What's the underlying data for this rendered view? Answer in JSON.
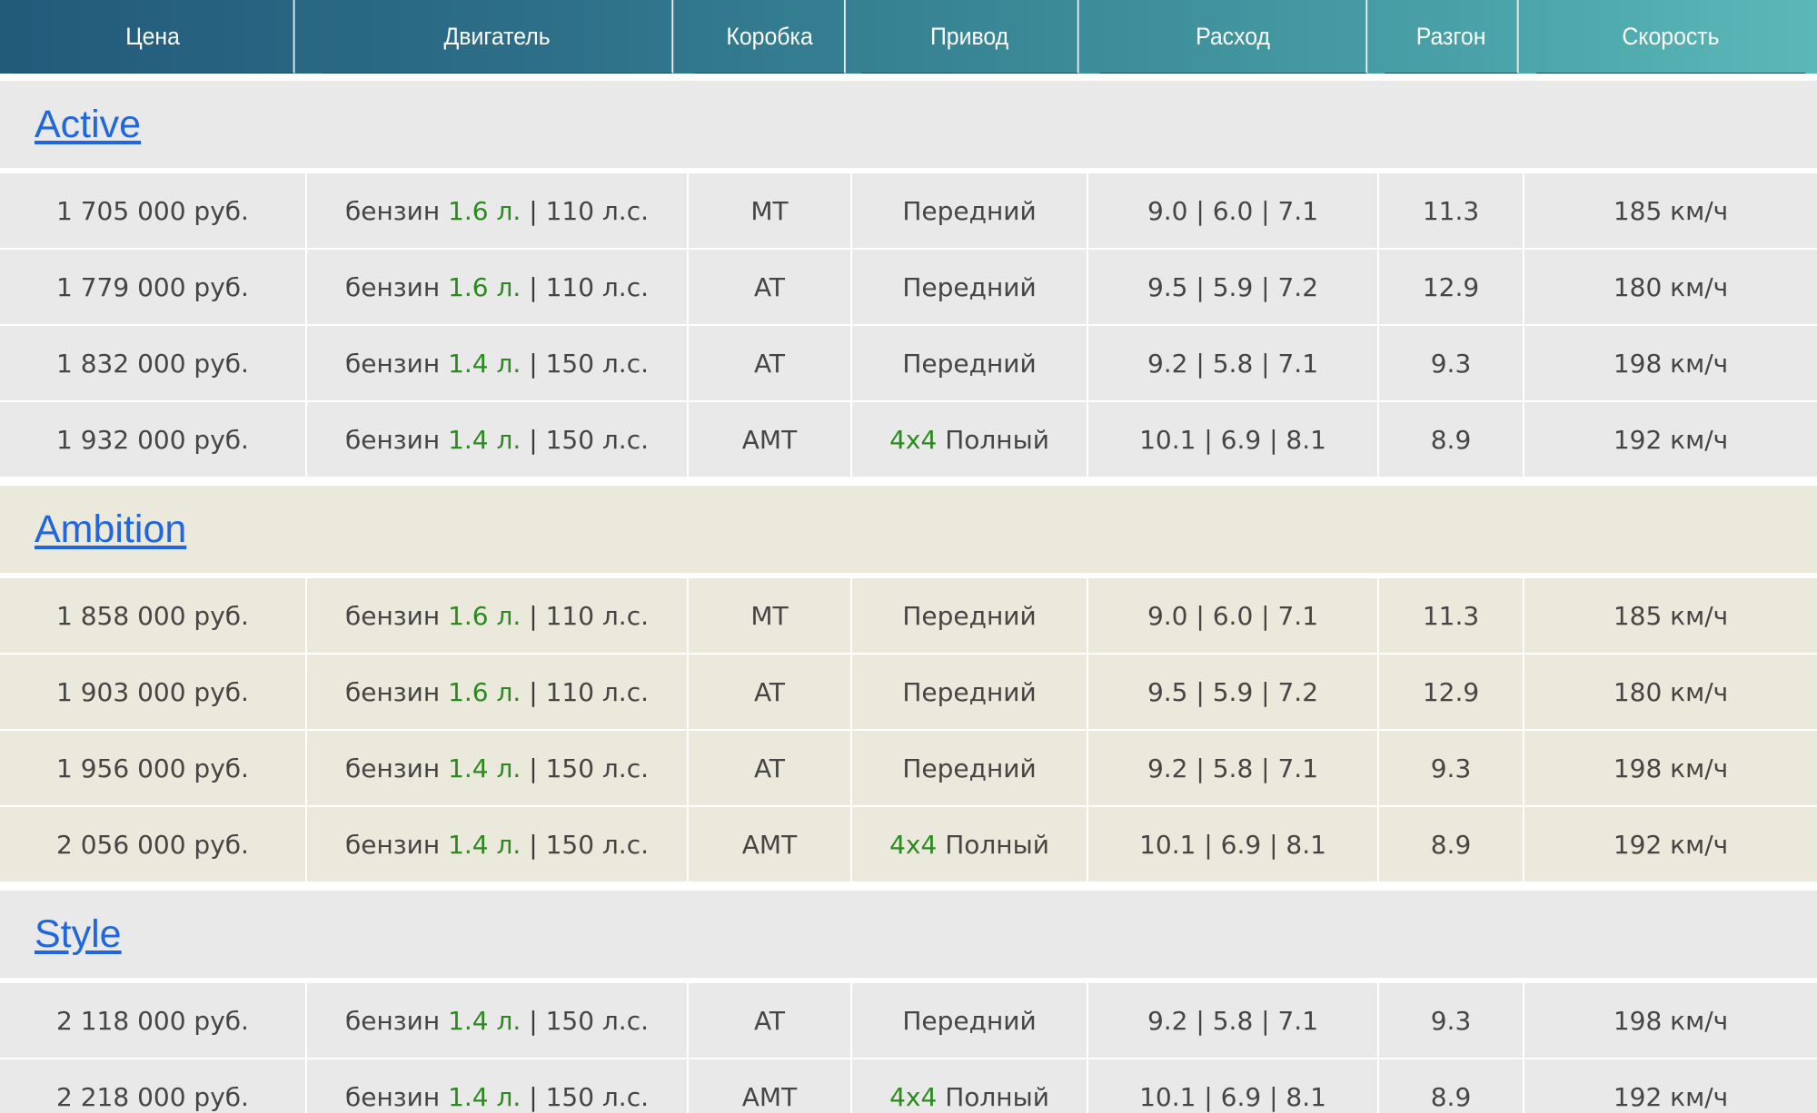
{
  "headers": [
    "Цена",
    "Двигатель",
    "Коробка",
    "Привод",
    "Расход",
    "Разгон",
    "Скорость"
  ],
  "groups": [
    {
      "name": "Active",
      "rows": [
        {
          "price": "1 705 000 руб.",
          "fuel": "бензин",
          "volume": "1.6 л.",
          "power": "110 л.с.",
          "gearbox": "MT",
          "drive_prefix": "",
          "drive": "Передний",
          "consumption": "9.0 | 6.0 | 7.1",
          "accel": "11.3",
          "speed": "185 км/ч"
        },
        {
          "price": "1 779 000 руб.",
          "fuel": "бензин",
          "volume": "1.6 л.",
          "power": "110 л.с.",
          "gearbox": "AT",
          "drive_prefix": "",
          "drive": "Передний",
          "consumption": "9.5 | 5.9 | 7.2",
          "accel": "12.9",
          "speed": "180 км/ч"
        },
        {
          "price": "1 832 000 руб.",
          "fuel": "бензин",
          "volume": "1.4 л.",
          "power": "150 л.с.",
          "gearbox": "AT",
          "drive_prefix": "",
          "drive": "Передний",
          "consumption": "9.2 | 5.8 | 7.1",
          "accel": "9.3",
          "speed": "198 км/ч"
        },
        {
          "price": "1 932 000 руб.",
          "fuel": "бензин",
          "volume": "1.4 л.",
          "power": "150 л.с.",
          "gearbox": "AMT",
          "drive_prefix": "4x4",
          "drive": "Полный",
          "consumption": "10.1 | 6.9 | 8.1",
          "accel": "8.9",
          "speed": "192 км/ч"
        }
      ]
    },
    {
      "name": "Ambition",
      "rows": [
        {
          "price": "1 858 000 руб.",
          "fuel": "бензин",
          "volume": "1.6 л.",
          "power": "110 л.с.",
          "gearbox": "MT",
          "drive_prefix": "",
          "drive": "Передний",
          "consumption": "9.0 | 6.0 | 7.1",
          "accel": "11.3",
          "speed": "185 км/ч"
        },
        {
          "price": "1 903 000 руб.",
          "fuel": "бензин",
          "volume": "1.6 л.",
          "power": "110 л.с.",
          "gearbox": "AT",
          "drive_prefix": "",
          "drive": "Передний",
          "consumption": "9.5 | 5.9 | 7.2",
          "accel": "12.9",
          "speed": "180 км/ч"
        },
        {
          "price": "1 956 000 руб.",
          "fuel": "бензин",
          "volume": "1.4 л.",
          "power": "150 л.с.",
          "gearbox": "AT",
          "drive_prefix": "",
          "drive": "Передний",
          "consumption": "9.2 | 5.8 | 7.1",
          "accel": "9.3",
          "speed": "198 км/ч"
        },
        {
          "price": "2 056 000 руб.",
          "fuel": "бензин",
          "volume": "1.4 л.",
          "power": "150 л.с.",
          "gearbox": "AMT",
          "drive_prefix": "4x4",
          "drive": "Полный",
          "consumption": "10.1 | 6.9 | 8.1",
          "accel": "8.9",
          "speed": "192 км/ч"
        }
      ]
    },
    {
      "name": "Style",
      "rows": [
        {
          "price": "2 118 000 руб.",
          "fuel": "бензин",
          "volume": "1.4 л.",
          "power": "150 л.с.",
          "gearbox": "AT",
          "drive_prefix": "",
          "drive": "Передний",
          "consumption": "9.2 | 5.8 | 7.1",
          "accel": "9.3",
          "speed": "198 км/ч"
        },
        {
          "price": "2 218 000 руб.",
          "fuel": "бензин",
          "volume": "1.4 л.",
          "power": "150 л.с.",
          "gearbox": "AMT",
          "drive_prefix": "4x4",
          "drive": "Полный",
          "consumption": "10.1 | 6.9 | 8.1",
          "accel": "8.9",
          "speed": "192 км/ч"
        }
      ]
    }
  ],
  "colors": {
    "header_gradient_start": "#225a7a",
    "header_gradient_end": "#5bb8b8",
    "link": "#1f66e0",
    "highlight_green": "#2a8a1d",
    "row_gray": "#e9e9e9",
    "row_beige": "#ebe9db"
  }
}
